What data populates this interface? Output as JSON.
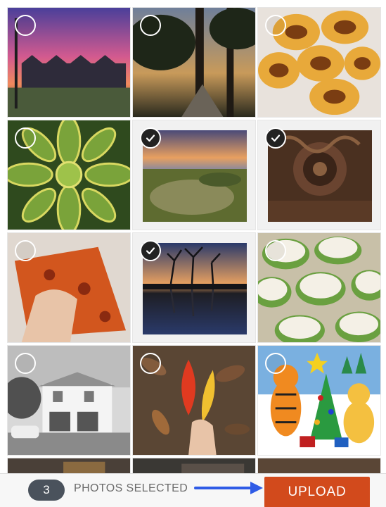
{
  "selection": {
    "count": "3",
    "label": "PHOTOS SELECTED"
  },
  "actions": {
    "upload_label": "UPLOAD"
  },
  "colors": {
    "upload_button": "#d24a1c",
    "badge": "#4a525c",
    "arrow": "#2f5be6",
    "check_selected": "#222222"
  },
  "icons": {
    "check": "checkmark-icon",
    "unchecked": "empty-circle-icon",
    "arrow": "right-arrow-icon"
  },
  "photos": [
    {
      "name": "sunset-houses-photo",
      "selected": false
    },
    {
      "name": "tree-path-photo",
      "selected": false
    },
    {
      "name": "creme-brulee-photo",
      "selected": false
    },
    {
      "name": "succulent-photo",
      "selected": false
    },
    {
      "name": "coastal-meadow-photo",
      "selected": true
    },
    {
      "name": "carved-wood-photo",
      "selected": true
    },
    {
      "name": "pizza-slice-photo",
      "selected": false
    },
    {
      "name": "lake-reflection-photo",
      "selected": true
    },
    {
      "name": "green-cookies-photo",
      "selected": false
    },
    {
      "name": "white-house-photo",
      "selected": false
    },
    {
      "name": "autumn-leaves-photo",
      "selected": false
    },
    {
      "name": "christmas-cartoon-photo",
      "selected": false
    },
    {
      "name": "partial-photo-1",
      "selected": false
    },
    {
      "name": "partial-photo-2",
      "selected": false
    },
    {
      "name": "partial-photo-3",
      "selected": false
    }
  ]
}
